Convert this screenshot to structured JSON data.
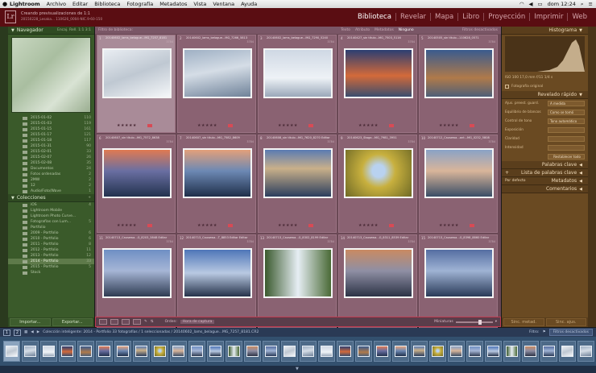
{
  "menubar": {
    "app": "Lightroom",
    "items": [
      "Archivo",
      "Editar",
      "Biblioteca",
      "Fotografía",
      "Metadatos",
      "Vista",
      "Ventana",
      "Ayuda"
    ],
    "clock": "dom 12:24"
  },
  "identity": {
    "logo": "Lr",
    "status_line1": "Creando previsualizaciones de 1:1",
    "status_line2": "20150228_Lesaka... 110626_0004-NIC.9-60-150"
  },
  "modules": [
    "Biblioteca",
    "Revelar",
    "Mapa",
    "Libro",
    "Proyección",
    "Imprimir",
    "Web"
  ],
  "active_module": "Biblioteca",
  "left": {
    "navigator_title": "Navegador",
    "navigator_extra": "Encaj.  Rell.  1:1  3:1",
    "folders": [
      {
        "name": "2015-01-02",
        "count": "110"
      },
      {
        "name": "2015-01-03",
        "count": "119"
      },
      {
        "name": "2015-01-15",
        "count": "161"
      },
      {
        "name": "2015-01-17",
        "count": "121"
      },
      {
        "name": "2015-01-18",
        "count": "117"
      },
      {
        "name": "2015-01-31",
        "count": "90"
      },
      {
        "name": "2015-02-01",
        "count": "33"
      },
      {
        "name": "2015-02-07",
        "count": "26"
      },
      {
        "name": "2015-02-08",
        "count": "35"
      },
      {
        "name": "Documentos",
        "count": "24"
      },
      {
        "name": "Fotos ordenadas",
        "count": "2"
      },
      {
        "name": "2MW",
        "count": "2"
      },
      {
        "name": "12",
        "count": "2"
      },
      {
        "name": "Audio/Foto/Wave",
        "count": "1"
      }
    ],
    "collections_title": "Colecciones",
    "collections": [
      {
        "name": "iOS",
        "count": "4"
      },
      {
        "name": "Lightroom Mobile",
        "count": ""
      },
      {
        "name": "Lightroom Photo Curve...",
        "count": ""
      },
      {
        "name": "Fotografías con Lum...",
        "count": "5"
      },
      {
        "name": "Portfolio",
        "count": ""
      },
      {
        "name": "2009 - Portfolio",
        "count": "6"
      },
      {
        "name": "2010 - Portfolio",
        "count": "6"
      },
      {
        "name": "2011 - Portfolio",
        "count": "8"
      },
      {
        "name": "2012 - Portfolio",
        "count": "11"
      },
      {
        "name": "2013 - Portfolio",
        "count": "12"
      },
      {
        "name": "2014 - Portfolio",
        "count": "33"
      },
      {
        "name": "2015 - Portfolio",
        "count": "5"
      },
      {
        "name": "Stock",
        "count": ""
      }
    ],
    "selected_collection": "2014 - Portfolio",
    "import_btn": "Importar...",
    "export_btn": "Exportar..."
  },
  "center": {
    "filter_label": "Filtro de biblioteca:",
    "filter_tabs": [
      "Texto",
      "Atributo",
      "Metadatos",
      "Ninguno"
    ],
    "filter_active": "Ninguno",
    "filter_right": "Filtros desactivados",
    "cells": [
      {
        "num": "1",
        "fname": "20140602_lams_belague...MG_7257_8181",
        "dim": "3784",
        "stars": "★★★★★",
        "thumb": "snow1",
        "sel": true
      },
      {
        "num": "2",
        "fname": "20140602_lams_belague...MG_7266_5813",
        "dim": "3784",
        "stars": "★★★★★",
        "thumb": "snow2",
        "sel": false
      },
      {
        "num": "3",
        "fname": "20140602_lams_belague...MG_7290_5240",
        "dim": "3784",
        "stars": "★★★★★",
        "thumb": "snow3",
        "sel": false
      },
      {
        "num": "4",
        "fname": "20140427_sin título...MG_7503_5116",
        "dim": "3784",
        "stars": "★★★★★",
        "thumb": "sunset1",
        "sel": false
      },
      {
        "num": "5",
        "fname": "20140505_sin título...110628_0571",
        "dim": "3784",
        "stars": "★★★★★",
        "thumb": "city1",
        "sel": false
      },
      {
        "num": "6",
        "fname": "20140607_sin título...MG_7572_8638",
        "dim": "3784",
        "stars": "★★★★★",
        "thumb": "mtn1",
        "sel": false
      },
      {
        "num": "7",
        "fname": "20140607_sin título...MG_7582_8609",
        "dim": "3784",
        "stars": "★★★★★",
        "thumb": "mtn2",
        "sel": false
      },
      {
        "num": "8",
        "fname": "20140608_sin título...MG_7620_8270 Editar",
        "dim": "3784",
        "stars": "★★★★★",
        "thumb": "river1",
        "sel": false
      },
      {
        "num": "9",
        "fname": "20140623_Staga...MG_7981_3951",
        "dim": "3784",
        "stars": "★★★★★",
        "thumb": "flower",
        "sel": false
      },
      {
        "num": "10",
        "fname": "20140712_Causewa...ant...MG_0232_5808",
        "dim": "3784",
        "stars": "★★★★★",
        "thumb": "coast1",
        "sel": false
      },
      {
        "num": "11",
        "fname": "20140713_Causewa...G_8203_5848 Editar",
        "dim": "3784",
        "stars": "",
        "thumb": "coast2",
        "sel": false
      },
      {
        "num": "12",
        "fname": "20140713_Causewa...T_8853 Editar Editar",
        "dim": "3784",
        "stars": "",
        "thumb": "coast3",
        "sel": false
      },
      {
        "num": "13",
        "fname": "20140713_Causewa...G_8302_8199 Editar",
        "dim": "3784",
        "stars": "",
        "thumb": "falls",
        "sel": false
      },
      {
        "num": "14",
        "fname": "20140713_Causewa...G_8311_8539 Editar",
        "dim": "3784",
        "stars": "",
        "thumb": "castle",
        "sel": false
      },
      {
        "num": "15",
        "fname": "20140713_Causewa...G_8398_8860 Editar",
        "dim": "3784",
        "stars": "",
        "thumb": "coast4",
        "sel": false
      }
    ],
    "sort_label": "Orden:",
    "sort_value": "Hora de captura",
    "thumbs_label": "Miniaturas"
  },
  "right": {
    "histogram_title": "Histograma",
    "histogram_readout": "ISO 100   17,0 mm   f/11   1/4 s",
    "original_photo": "Fotografía original",
    "quick_develop_title": "Revelado rápido",
    "rows": [
      {
        "label": "Ajus. preest. guard.",
        "value": "A medida"
      },
      {
        "label": "Equilibrio de blancos",
        "value": "Como se tomó"
      },
      {
        "label": "Control de tono",
        "value": "Tono automático"
      },
      {
        "label": "Exposición",
        "value": ""
      },
      {
        "label": "Claridad",
        "value": ""
      },
      {
        "label": "Intensidad",
        "value": ""
      }
    ],
    "reset_all": "Restablecer todo",
    "keywording": "Palabras clave",
    "keyword_list": "Lista de palabras clave",
    "metadata_title": "Metadatos",
    "metadata_preset": "Por defecto",
    "comments": "Comentarios",
    "sync_btn": "Sinc. metad.",
    "sync2_btn": "Sinc. ajus."
  },
  "filmstrip": {
    "screen1": "1",
    "screen2": "2",
    "path": "Colección inteligente: 2014 - Portfolio   33 fotografías / 1 seleccionadas / 20140602_lams_belague...MG_7257_8181.CR2",
    "filter_label": "Filtro:",
    "filter_value": "Filtros desactivados"
  },
  "colors": {
    "identity_bg": "#5a0d12",
    "left_panel": "#3a5a2a",
    "grid_bg": "#6a4855",
    "right_panel": "#6a4a22",
    "filmstrip_bg": "#33506e",
    "flag_red": "#d84a55"
  }
}
